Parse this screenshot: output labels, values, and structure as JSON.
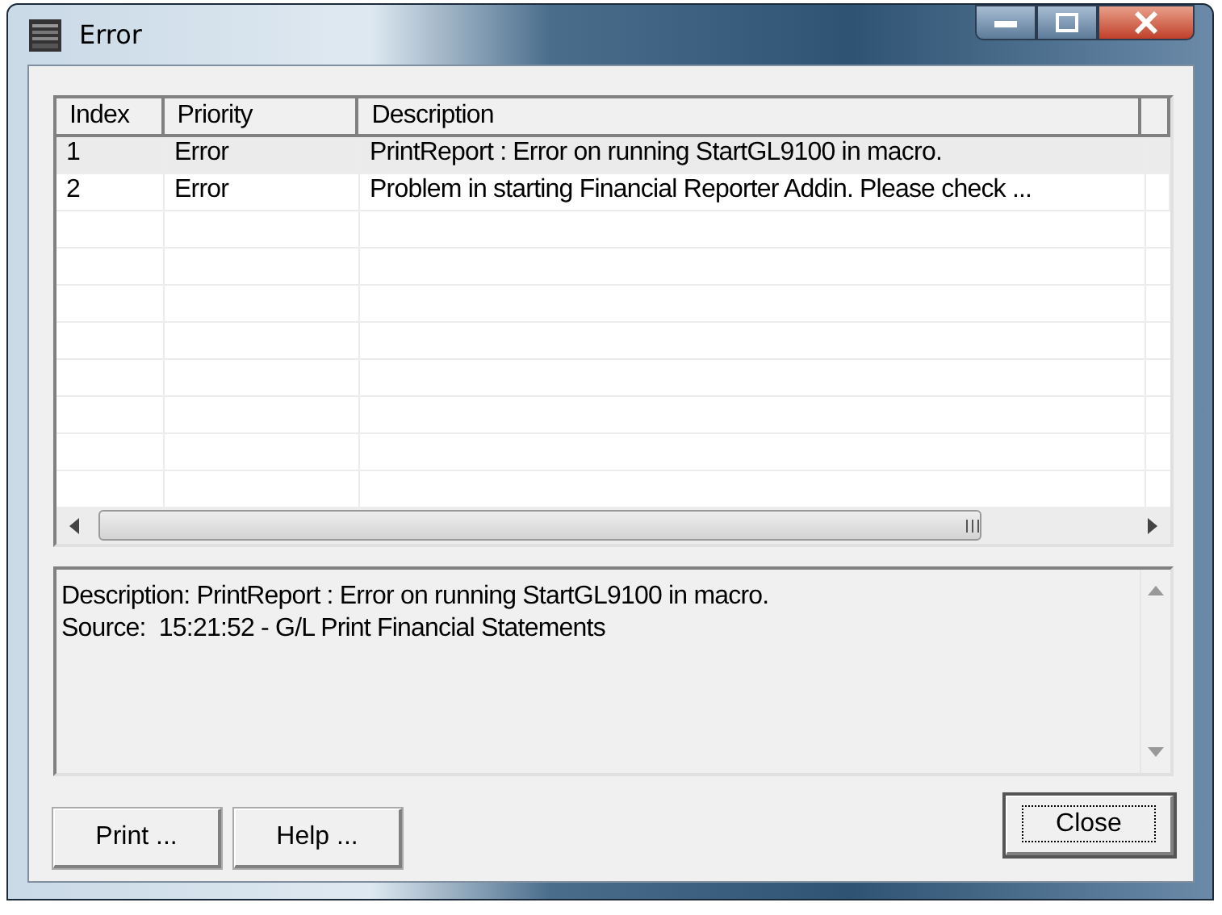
{
  "window": {
    "title": "Error"
  },
  "table": {
    "columns": [
      "Index",
      "Priority",
      "Description"
    ],
    "rows": [
      {
        "index": "1",
        "priority": "Error",
        "description": "PrintReport : Error on running StartGL9100 in macro.",
        "selected": true
      },
      {
        "index": "2",
        "priority": "Error",
        "description": "Problem in starting Financial Reporter Addin. Please check ...",
        "selected": false
      }
    ]
  },
  "details": [
    "Description: PrintReport : Error on running StartGL9100 in macro.",
    "Source:  15:21:52 - G/L Print Financial Statements"
  ],
  "buttons": [
    {
      "label": "Print ...",
      "focused": false
    },
    {
      "label": "Help ...",
      "focused": false
    },
    {
      "label": "Close",
      "focused": true
    }
  ]
}
